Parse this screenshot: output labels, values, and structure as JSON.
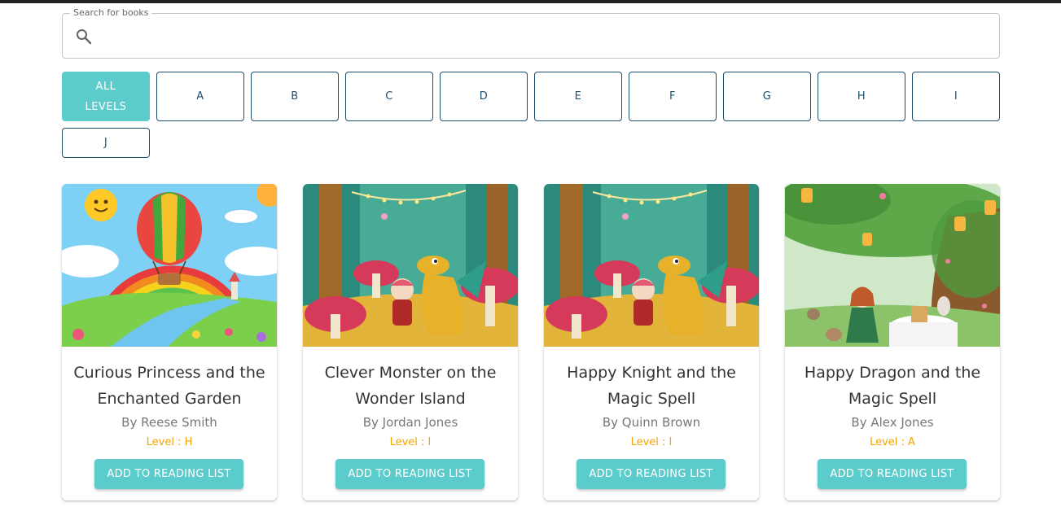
{
  "search": {
    "label": "Search for books",
    "value": "",
    "placeholder": ""
  },
  "levels": {
    "all_label_line1": "ALL",
    "all_label_line2": "LEVELS",
    "items": [
      "A",
      "B",
      "C",
      "D",
      "E",
      "F",
      "G",
      "H",
      "I",
      "J"
    ],
    "selected": "ALL LEVELS"
  },
  "books": [
    {
      "title": "Curious Princess and the Enchanted Garden",
      "author": "By Reese Smith",
      "level": "Level : H",
      "button": "ADD TO READING LIST",
      "cover_theme": "rainbow-hot-air-balloon"
    },
    {
      "title": "Clever Monster on the Wonder Island",
      "author": "By Jordan Jones",
      "level": "Level : I",
      "button": "ADD TO READING LIST",
      "cover_theme": "enchanted-forest-dragon"
    },
    {
      "title": "Happy Knight and the Magic Spell",
      "author": "By Quinn Brown",
      "level": "Level : I",
      "button": "ADD TO READING LIST",
      "cover_theme": "enchanted-forest-dragon"
    },
    {
      "title": "Happy Dragon and the Magic Spell",
      "author": "By Alex Jones",
      "level": "Level : A",
      "button": "ADD TO READING LIST",
      "cover_theme": "forest-tea-party"
    }
  ],
  "colors": {
    "accent": "#5ccbcb",
    "level_text": "#f0a500",
    "filter_border": "#1e4e6e"
  }
}
